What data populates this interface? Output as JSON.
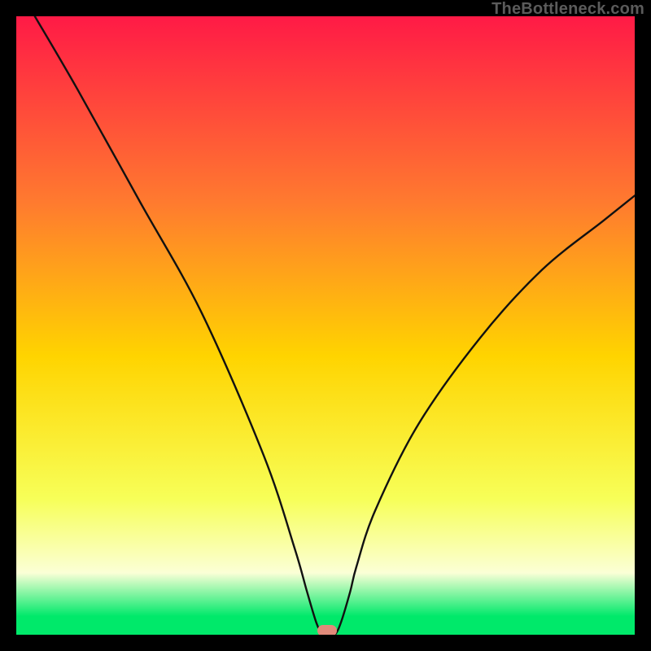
{
  "attribution": "TheBottleneck.com",
  "colors": {
    "top": "#ff1a46",
    "mid_upper": "#ff7a2f",
    "mid": "#ffd400",
    "mid_lower": "#f7ff58",
    "pale": "#fbffd6",
    "green": "#00e96a",
    "marker": "#e08a7a",
    "curve": "#111111",
    "frame": "#000000"
  },
  "chart_data": {
    "type": "line",
    "title": "",
    "xlabel": "",
    "ylabel": "",
    "xlim": [
      0,
      100
    ],
    "ylim": [
      0,
      100
    ],
    "x": [
      3,
      10,
      20,
      30,
      40,
      45,
      47,
      48.5,
      49.5,
      50.3,
      51.5,
      52.5,
      54,
      55,
      58,
      65,
      75,
      85,
      95,
      100
    ],
    "values": [
      100,
      88,
      70,
      52,
      29,
      14,
      7,
      2,
      0,
      0,
      0,
      2,
      7,
      11,
      20,
      34,
      48,
      59,
      67,
      71
    ],
    "series": [
      {
        "name": "bottleneck-curve",
        "values": [
          100,
          88,
          70,
          52,
          29,
          14,
          7,
          2,
          0,
          0,
          0,
          2,
          7,
          11,
          20,
          34,
          48,
          59,
          67,
          71
        ]
      }
    ],
    "marker": {
      "x": 50.3,
      "y": 0
    },
    "gradient_stops": [
      {
        "pct": 0,
        "key": "top"
      },
      {
        "pct": 30,
        "key": "mid_upper"
      },
      {
        "pct": 55,
        "key": "mid"
      },
      {
        "pct": 78,
        "key": "mid_lower"
      },
      {
        "pct": 90,
        "key": "pale"
      },
      {
        "pct": 97,
        "key": "green"
      },
      {
        "pct": 100,
        "key": "green"
      }
    ]
  }
}
